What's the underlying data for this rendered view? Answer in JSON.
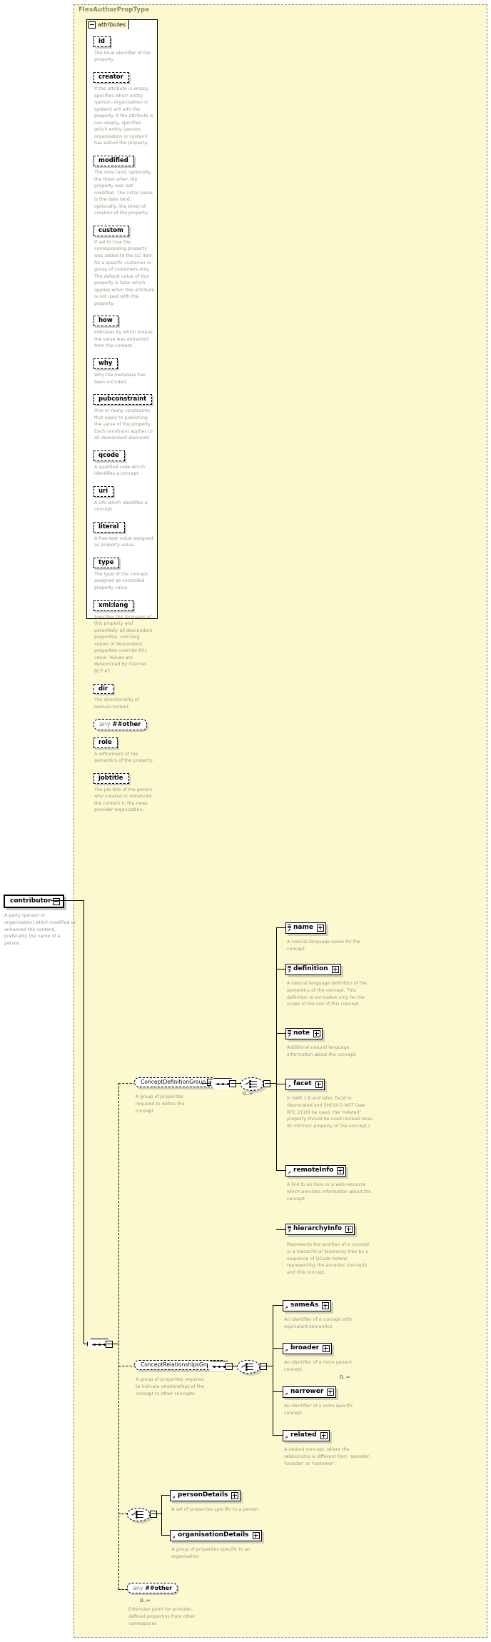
{
  "type_panel": {
    "title": "FlexAuthorPropType"
  },
  "attributes_box": {
    "tab_label": "attributes",
    "items": [
      {
        "name": "id",
        "desc": "The local identifier of the property."
      },
      {
        "name": "creator",
        "desc": "If the attribute is empty, specifies which entity (person, organisation or system) will edit the property. If the attribute is non-empty, specifies which entity (person, organisation or system) has edited the property."
      },
      {
        "name": "modified",
        "desc": "The date (and, optionally, the time) when the property was last modified. The initial value is the date (and, optionally, the time) of creation of the property."
      },
      {
        "name": "custom",
        "desc": "If set to true the corresponding property was added to the G2 Item for a specific customer or group of customers only. The default value of this property is false which applies when this attribute is not used with the property."
      },
      {
        "name": "how",
        "desc": "Indicates by which means the value was extracted from the content."
      },
      {
        "name": "why",
        "desc": "Why the metadata has been included."
      },
      {
        "name": "pubconstraint",
        "desc": "One or many constraints that apply to publishing the value of the property. Each constraint applies to all descendant elements."
      },
      {
        "name": "qcode",
        "desc": "A qualified code which identifies a concept."
      },
      {
        "name": "uri",
        "desc": "A URI which identifies a concept."
      },
      {
        "name": "literal",
        "desc": "A free-text value assigned as property value."
      },
      {
        "name": "type",
        "desc": "The type of the concept assigned as controlled property value."
      },
      {
        "name": "xml:lang",
        "desc": "Specifies the language of this property and potentially all descendant properties. xml:lang values of descendant properties override this value. Values are determined by Internet BCP 47."
      },
      {
        "name": "dir",
        "desc": "The directionality of textual content."
      },
      {
        "name": "any ##other",
        "is_any": true,
        "any_prefix": "any",
        "any_ns": "##other",
        "desc": ""
      },
      {
        "name": "role",
        "desc": "A refinement of the semantics of the property."
      },
      {
        "name": "jobtitle",
        "desc": "The job title of the person who created or enhanced the content in the news provider organisation."
      }
    ]
  },
  "root_element": {
    "name": "contributor",
    "desc": "A party (person or organisation) which modified or enhanced the content, preferably the name of a person."
  },
  "groups": {
    "definition_group": {
      "label": "ConceptDefinitionGroup",
      "desc": "A group of properites required to define the concept",
      "cardinality": "0..∞"
    },
    "relationships_group": {
      "label": "ConceptRelationshipsGroup",
      "desc": "A group of properites required to indicate relationships of the concept to other concepts",
      "cardinality": "0..∞"
    }
  },
  "definition_elements": [
    {
      "name": "name",
      "desc": "A natural language name for the concept."
    },
    {
      "name": "definition",
      "desc": "A natural language definition of the semantics of the concept. This definition is normative only for the scope of the use of this concept."
    },
    {
      "name": "note",
      "desc": "Additional natural language information about the concept."
    },
    {
      "name": "facet",
      "desc": "In NAR 1.8 and later, facet is deprecated and SHOULD NOT (see RFC 2119) be used, the \"related\" property should be used instead (was: An intrinsic property of the concept.)"
    },
    {
      "name": "remoteInfo",
      "desc": "A link to an item or a web resource which provides information about the concept"
    },
    {
      "name": "hierarchyInfo",
      "desc": "Represents the position of a concept in a hierarchical taxonomy tree by a sequence of QCode tokens representing the ancestor concepts and this concept"
    }
  ],
  "relationship_elements": [
    {
      "name": "sameAs",
      "desc": "An identifier of a concept with equivalent semantics"
    },
    {
      "name": "broader",
      "desc": "An identifier of a more generic concept."
    },
    {
      "name": "narrower",
      "desc": "An identifier of a more specific concept."
    },
    {
      "name": "related",
      "desc": "A related concept, where the relationship is different from 'sameAs', 'broader' or 'narrower'."
    }
  ],
  "details_elements": [
    {
      "name": "personDetails",
      "desc": "A set of properties specific to a person"
    },
    {
      "name": "organisationDetails",
      "desc": "A group of properties specific to an organisation"
    }
  ],
  "extension_point": {
    "any_prefix": "any",
    "any_ns": "##other",
    "cardinality": "0..∞",
    "desc": "Extension point for provider-defined properties from other namespaces"
  },
  "colors": {
    "panel_bg": "#fbf9cd",
    "desc_text": "#9a9a8c",
    "shadow": "#cfcfbf"
  }
}
